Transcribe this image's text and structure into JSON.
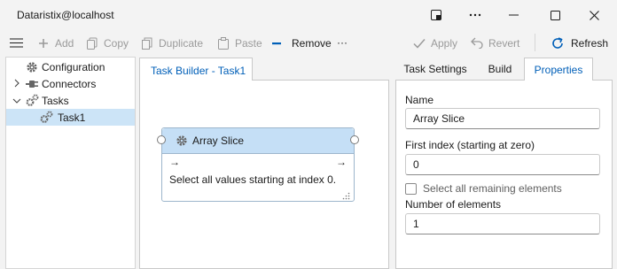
{
  "window": {
    "title": "Dataristix@localhost"
  },
  "toolbar": {
    "add": "Add",
    "copy": "Copy",
    "duplicate": "Duplicate",
    "paste": "Paste",
    "remove": "Remove",
    "more": "···",
    "apply": "Apply",
    "revert": "Revert",
    "refresh": "Refresh"
  },
  "tree": {
    "items": [
      {
        "label": "Configuration",
        "icon": "gear-icon"
      },
      {
        "label": "Connectors",
        "icon": "plug-icon"
      },
      {
        "label": "Tasks",
        "icon": "gears-icon"
      },
      {
        "label": "Task1",
        "icon": "gears-icon",
        "selected": true
      }
    ]
  },
  "canvas": {
    "tab_label": "Task Builder - Task1",
    "node": {
      "title": "Array Slice",
      "in_arrow": "→",
      "out_arrow": "→",
      "description": "Select all values starting at index 0."
    }
  },
  "properties": {
    "tabs": [
      "Task Settings",
      "Build",
      "Properties"
    ],
    "active_tab": "Properties",
    "name_label": "Name",
    "name_value": "Array Slice",
    "first_index_label": "First index (starting at zero)",
    "first_index_value": "0",
    "select_all_label": "Select all remaining elements",
    "select_all_checked": false,
    "num_elements_label": "Number of elements",
    "num_elements_value": "1"
  },
  "colors": {
    "accent": "#005fb8",
    "node_header": "#c5dff6",
    "selection": "#cce4f7",
    "disabled_text": "#9a9a9a"
  }
}
